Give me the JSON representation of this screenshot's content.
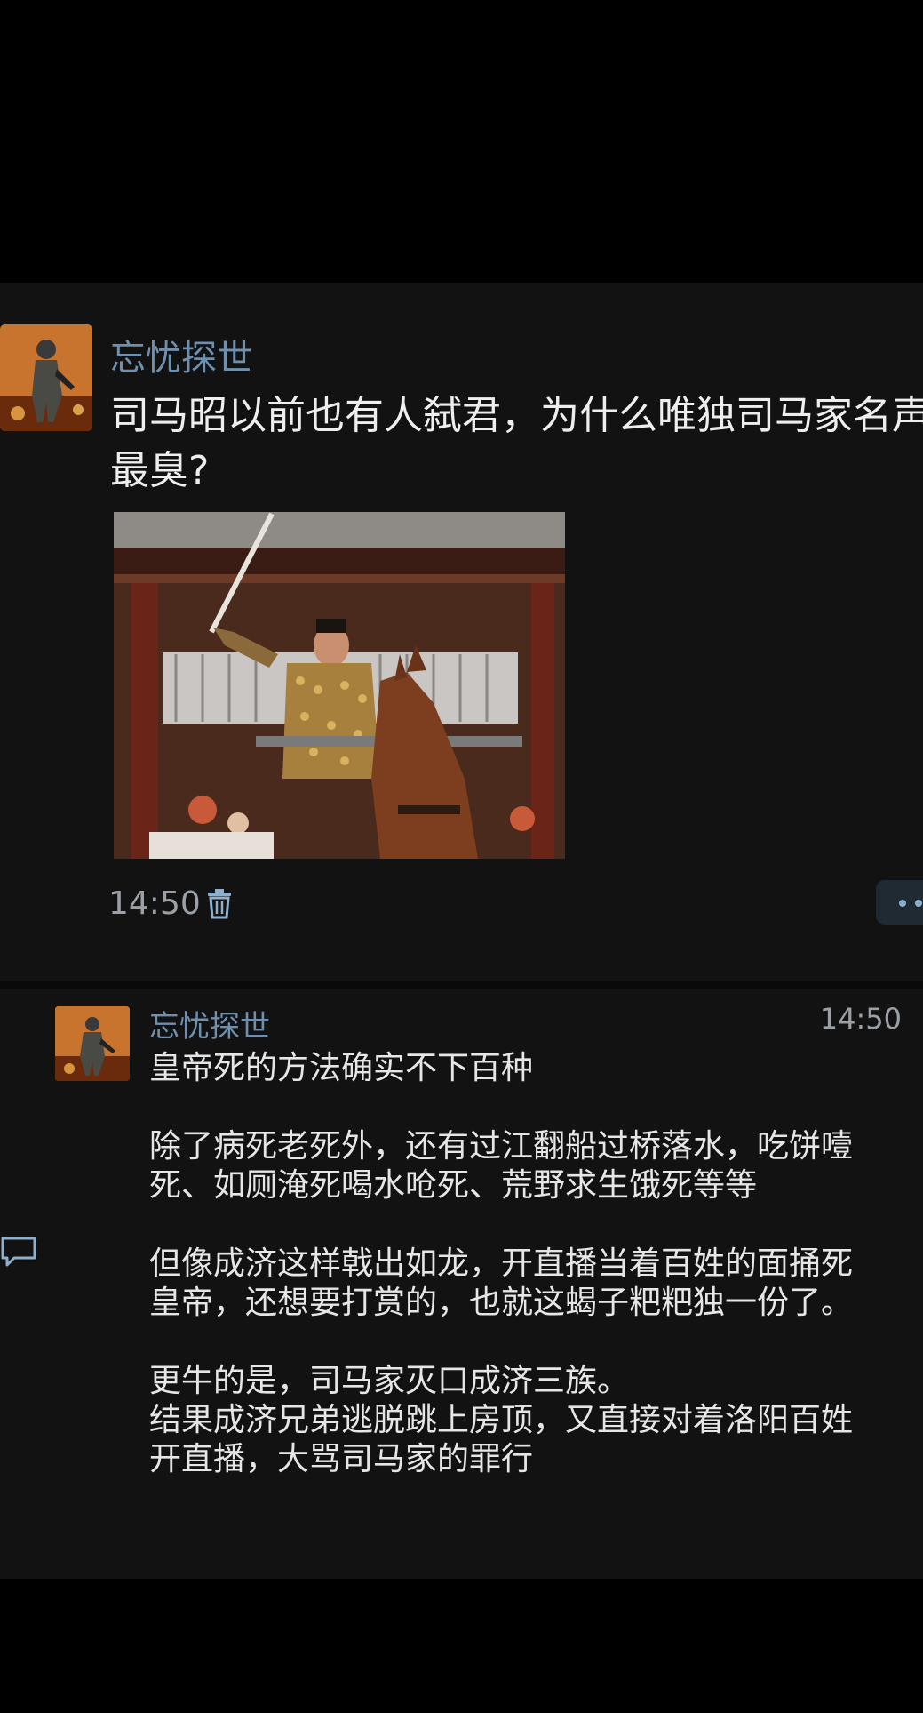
{
  "post": {
    "author": "忘忧探世",
    "text_line1": "司马昭以前也有人弑君，为什么唯独司马家名声",
    "text_line2": "最臭?",
    "time": "14:50"
  },
  "reply": {
    "author": "忘忧探世",
    "time": "14:50",
    "paragraphs": [
      [
        "皇帝死的方法确实不下百种"
      ],
      [
        "除了病死老死外，还有过江翻船过桥落水，吃饼噎",
        "死、如厕淹死喝水呛死、荒野求生饿死等等"
      ],
      [
        "但像成济这样戟出如龙，开直播当着百姓的面捅死",
        "皇帝，还想要打赏的，也就这蝎子粑粑独一份了。"
      ],
      [
        "更牛的是，司马家灭口成济三族。",
        "结果成济兄弟逃脱跳上房顶，又直接对着洛阳百姓",
        "开直播，大骂司马家的罪行"
      ]
    ]
  },
  "icons": {
    "delete": "trash-icon",
    "more": "more-dots-icon",
    "comment": "comment-icon",
    "avatar": "soldier-avatar"
  },
  "colors": {
    "background": "#000000",
    "panel": "#121212",
    "author_name": "#6e8fae",
    "timestamp": "#9aa0a6"
  }
}
